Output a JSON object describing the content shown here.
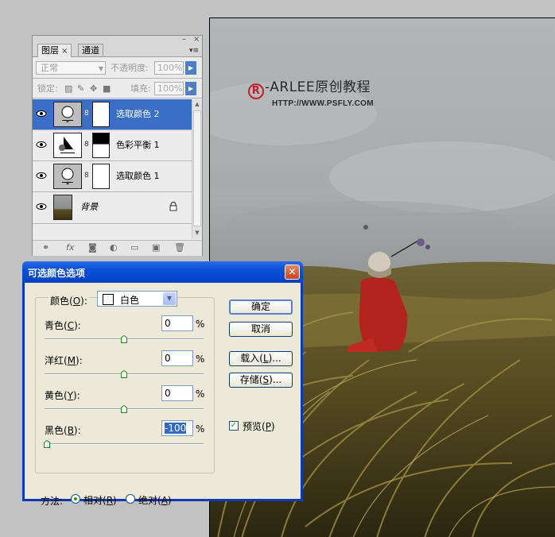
{
  "watermark": {
    "brand": "-ARLEE原创教程",
    "registered_mark": "R",
    "url": "HTTP://WWW.PSFLY.COM"
  },
  "layers_panel": {
    "tabs": [
      {
        "label": "图层",
        "close": "×"
      },
      {
        "label": "通道"
      }
    ],
    "blend_mode": "正常",
    "opacity_label": "不透明度:",
    "opacity_value": "100%",
    "lock_label": "锁定:",
    "fill_label": "填充:",
    "fill_value": "100%",
    "layers": [
      {
        "name": "选取颜色 2",
        "selected": true,
        "type": "selective-color"
      },
      {
        "name": "色彩平衡 1",
        "selected": false,
        "type": "color-balance"
      },
      {
        "name": "选取颜色 1",
        "selected": false,
        "type": "selective-color"
      },
      {
        "name": "背景",
        "selected": false,
        "type": "background",
        "locked": true
      }
    ]
  },
  "dialog": {
    "title": "可选颜色选项",
    "colors_label": "颜色(",
    "colors_key": "O",
    "colors_label_end": "):",
    "color_value": "白色",
    "channels": [
      {
        "label": "青色(",
        "key": "C",
        "end": "):",
        "value": "0",
        "unit": "%",
        "slider": 0.5
      },
      {
        "label": "洋红(",
        "key": "M",
        "end": "):",
        "value": "0",
        "unit": "%",
        "slider": 0.5
      },
      {
        "label": "黄色(",
        "key": "Y",
        "end": "):",
        "value": "0",
        "unit": "%",
        "slider": 0.5
      },
      {
        "label": "黑色(",
        "key": "B",
        "end": "):",
        "value": "-100",
        "unit": "%",
        "slider": 0.0
      }
    ],
    "buttons": {
      "ok": "确定",
      "cancel": "取消",
      "load": "载入(",
      "load_key": "L",
      "load_end": ")...",
      "save": "存储(",
      "save_key": "S",
      "save_end": ")..."
    },
    "preview": {
      "label": "预览(",
      "key": "P",
      "end": ")",
      "checked": true
    },
    "method": {
      "label": "方法:",
      "options": [
        {
          "label": "相对(",
          "key": "R",
          "end": ")",
          "checked": true
        },
        {
          "label": "绝对(",
          "key": "A",
          "end": ")",
          "checked": false
        }
      ]
    }
  },
  "colors": {
    "selected_layer": "#3a6fc5",
    "title_bar": "#0a4fd8",
    "dialog_face": "#ece9d8",
    "close_button": "#c8461e"
  }
}
